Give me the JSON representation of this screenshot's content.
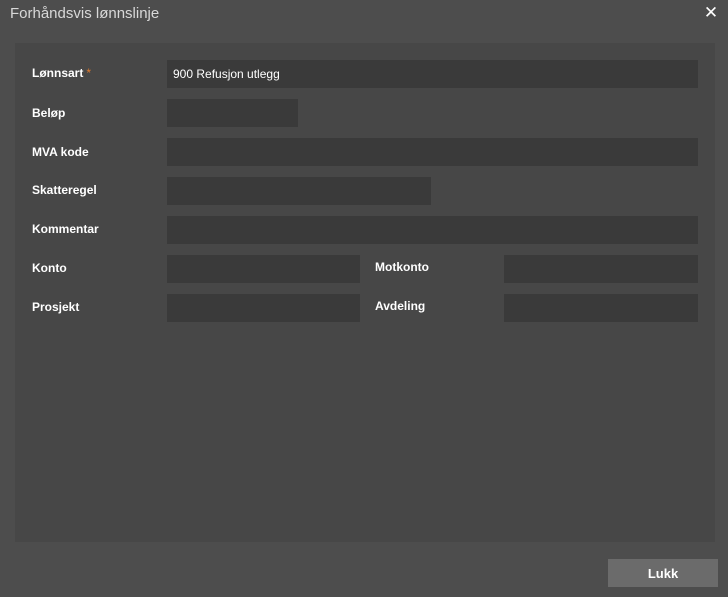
{
  "dialog": {
    "title": "Forhåndsvis lønnslinje",
    "close_glyph": "✕"
  },
  "form": {
    "lonnsart": {
      "label": "Lønnsart",
      "required_mark": "*",
      "value": "900 Refusjon utlegg"
    },
    "belop": {
      "label": "Beløp",
      "value": ""
    },
    "mva_kode": {
      "label": "MVA kode",
      "value": ""
    },
    "skatteregel": {
      "label": "Skatteregel",
      "value": ""
    },
    "kommentar": {
      "label": "Kommentar",
      "value": ""
    },
    "konto": {
      "label": "Konto",
      "value": ""
    },
    "motkonto": {
      "label": "Motkonto",
      "value": ""
    },
    "prosjekt": {
      "label": "Prosjekt",
      "value": ""
    },
    "avdeling": {
      "label": "Avdeling",
      "value": ""
    }
  },
  "footer": {
    "close_label": "Lukk"
  },
  "colors": {
    "background": "#4d4d4d",
    "panel": "#474747",
    "field": "#3a3a3a",
    "required": "#e07b2e",
    "button": "#6b6b6b"
  }
}
